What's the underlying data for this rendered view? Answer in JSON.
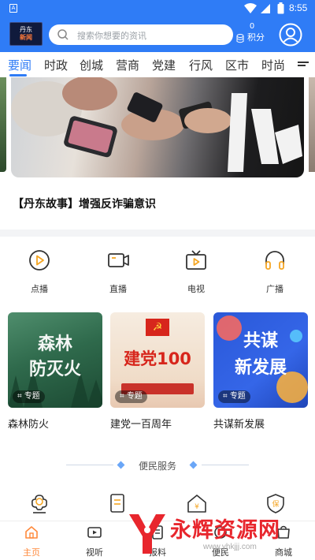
{
  "status_bar": {
    "badge": "A",
    "time": "8:55"
  },
  "header": {
    "logo_line1": "丹东",
    "logo_line2": "新闻",
    "search_placeholder": "搜索你想要的资讯",
    "points_value": "0",
    "points_label": "积分"
  },
  "tabs": [
    {
      "label": "要闻",
      "active": true
    },
    {
      "label": "时政"
    },
    {
      "label": "创城"
    },
    {
      "label": "营商"
    },
    {
      "label": "党建"
    },
    {
      "label": "行风"
    },
    {
      "label": "区市"
    },
    {
      "label": "时尚"
    }
  ],
  "banner": {
    "title": "【丹东故事】增强反诈骗意识"
  },
  "quick_nav": [
    {
      "label": "点播",
      "icon": "play-circle-icon"
    },
    {
      "label": "直播",
      "icon": "live-camera-icon"
    },
    {
      "label": "电视",
      "icon": "tv-icon"
    },
    {
      "label": "广播",
      "icon": "headphones-icon"
    }
  ],
  "topics": [
    {
      "image_text": "森林\n防灭火",
      "tag": "专题",
      "caption": "森林防火"
    },
    {
      "image_text": "建党100",
      "tag": "专题",
      "caption": "建党一百周年"
    },
    {
      "image_text": "共谋\n新发展",
      "tag": "专题",
      "caption": "共谋新发展"
    }
  ],
  "services": {
    "heading": "便民服务"
  },
  "bottom_nav": [
    {
      "label": "主页",
      "icon": "home-icon",
      "active": true
    },
    {
      "label": "视听",
      "icon": "video-icon"
    },
    {
      "label": "报料",
      "icon": "report-icon"
    },
    {
      "label": "便民",
      "icon": "service-icon"
    },
    {
      "label": "商城",
      "icon": "shop-icon"
    }
  ],
  "watermark": {
    "text": "永辉资源网",
    "url": "www.yhkjjj.com"
  },
  "colors": {
    "brand_blue": "#2f7cf6",
    "accent_orange": "#f5a623",
    "nav_active": "#ff8a3c"
  }
}
